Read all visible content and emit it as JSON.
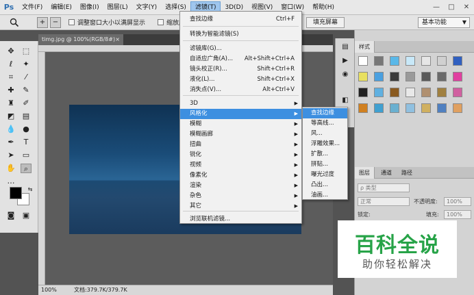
{
  "app": {
    "logo": "Ps"
  },
  "menubar": {
    "items": [
      "文件(F)",
      "编辑(E)",
      "图像(I)",
      "图层(L)",
      "文字(Y)",
      "选择(S)",
      "滤镜(T)",
      "3D(D)",
      "视图(V)",
      "窗口(W)",
      "帮助(H)"
    ],
    "active_index": 6,
    "window_controls": [
      "—",
      "□",
      "✕"
    ]
  },
  "options_bar": {
    "zoom_tool_icon": "zoom-icon",
    "zoom_in": "+",
    "zoom_out": "−",
    "resize_windows": "调整窗口大小以满屏显示",
    "zoom_all": "缩放所有",
    "fill_screen": "填充屏幕",
    "workspace": "基本功能"
  },
  "document": {
    "tab_title": "timg.jpg @ 100%(RGB/8#)",
    "tab_close": "×",
    "zoom": "100%",
    "doc_size": "文档:379.7K/379.7K",
    "photo_colors": {
      "sky": "#1a4c78",
      "sea": "#1c4a72"
    }
  },
  "filter_menu": {
    "items": [
      {
        "label": "查找边缘",
        "shortcut": "Ctrl+F"
      },
      {
        "label": "转换为智能滤镜(S)",
        "shortcut": ""
      },
      {
        "label": "滤镜库(G)...",
        "shortcut": ""
      },
      {
        "label": "自适应广角(A)...",
        "shortcut": "Alt+Shift+Ctrl+A"
      },
      {
        "label": "镜头校正(R)...",
        "shortcut": "Shift+Ctrl+R"
      },
      {
        "label": "液化(L)...",
        "shortcut": "Shift+Ctrl+X"
      },
      {
        "label": "消失点(V)...",
        "shortcut": "Alt+Ctrl+V"
      },
      {
        "label": "3D",
        "shortcut": ""
      },
      {
        "label": "风格化",
        "shortcut": ""
      },
      {
        "label": "模糊",
        "shortcut": ""
      },
      {
        "label": "模糊画廊",
        "shortcut": ""
      },
      {
        "label": "扭曲",
        "shortcut": ""
      },
      {
        "label": "锐化",
        "shortcut": ""
      },
      {
        "label": "视频",
        "shortcut": ""
      },
      {
        "label": "像素化",
        "shortcut": ""
      },
      {
        "label": "渲染",
        "shortcut": ""
      },
      {
        "label": "杂色",
        "shortcut": ""
      },
      {
        "label": "其它",
        "shortcut": ""
      },
      {
        "label": "浏览联机滤镜...",
        "shortcut": ""
      }
    ],
    "highlighted": "风格化"
  },
  "stylize_submenu": {
    "items": [
      "查找边缘",
      "等高线...",
      "风...",
      "浮雕效果...",
      "扩散...",
      "拼贴...",
      "曝光过度",
      "凸出...",
      "油画..."
    ],
    "highlighted": "查找边缘"
  },
  "styles_panel": {
    "tab": "样式",
    "colors": [
      "#ffffff",
      "#777777",
      "#5ab8e8",
      "#c8e8f8",
      "#e6e6e6",
      "#d0d0d0",
      "#3060c0",
      "#e8e060",
      "#4aa0e0",
      "#3a3a3a",
      "#9a9a9a",
      "#5a5a5a",
      "#6a6a6a",
      "#e040a0",
      "#222222",
      "#60b0e0",
      "#8a5a20",
      "#e8e8e8",
      "#b09070",
      "#a08040",
      "#d060a0",
      "#d08020",
      "#40a0d0",
      "#6ab0d0",
      "#90c0e0",
      "#d0b060",
      "#5080c0",
      "#e0a060"
    ]
  },
  "layers_panel": {
    "tabs": [
      "图层",
      "通道",
      "路径"
    ],
    "kind_filter": "ρ 类型",
    "blend_mode": "正常",
    "opacity_label": "不透明度:",
    "opacity_value": "100%",
    "lock_label": "锁定:",
    "fill_label": "填充:",
    "fill_value": "100%"
  },
  "watermark": {
    "title": "百科全说",
    "subtitle": "助你轻松解决"
  }
}
